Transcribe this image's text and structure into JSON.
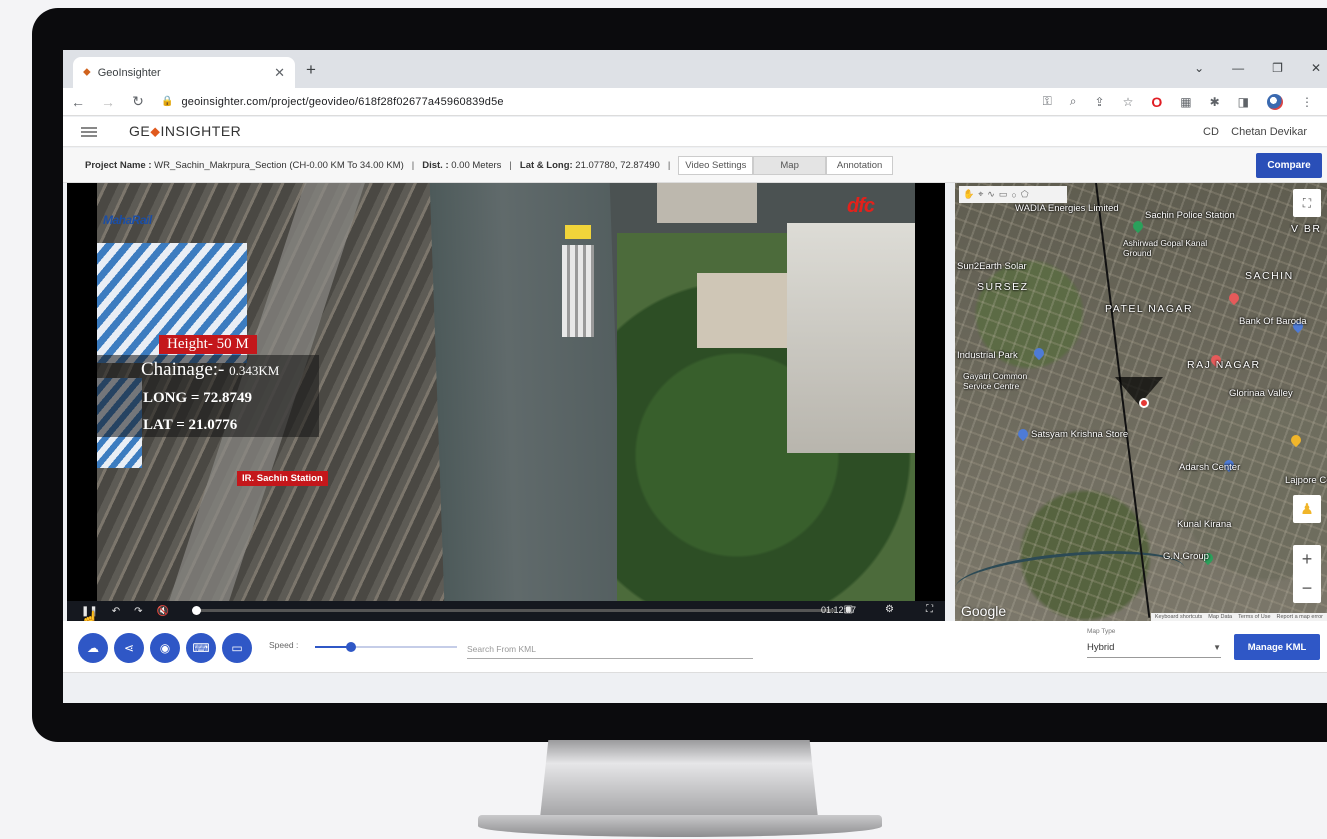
{
  "browser": {
    "tab_title": "GeoInsighter",
    "tab_close": "✕",
    "new_tab": "+",
    "url": "geoinsighter.com/project/geovideo/618f28f02677a45960839d5e",
    "window_controls": [
      "⌄",
      "—",
      "❐",
      "✕"
    ]
  },
  "app": {
    "logo_left": "GE",
    "logo_pin": "⬥",
    "logo_right": "INSIGHTER",
    "user_initials": "CD",
    "user_name": "Chetan Devikar"
  },
  "project_bar": {
    "project_label": "Project Name :",
    "project_value": "WR_Sachin_Makrpura_Section (CH-0.00 KM To 34.00 KM)",
    "dist_label": "Dist. :",
    "dist_value": "0.00 Meters",
    "latlong_label": "Lat & Long:",
    "latlong_value": "21.07780, 72.87490",
    "tabs": [
      "Video Settings",
      "Map",
      "Annotation"
    ],
    "compare_label": "Compare"
  },
  "video": {
    "watermark_left": "MahaRail",
    "watermark_right": "dfc",
    "overlay_height": "Height- 50 M",
    "overlay_chainage_label": "Chainage:- ",
    "overlay_chainage_value": "0.343KM",
    "overlay_long": "LONG = 72.8749",
    "overlay_lat": "LAT = 21.0776",
    "overlay_station": "IR. Sachin Station",
    "time": "01:12:57",
    "progress": 0.0
  },
  "map": {
    "labels": [
      "Sachin Police Station",
      "Ashirwad Gopal Kanal Ground",
      "Sun2Earth Solar",
      "SURSEZ",
      "PATEL NAGAR",
      "Bank Of Baroda",
      "SACHIN",
      "RAJ NAGAR",
      "Glorinaa Valley",
      "Industrial Park",
      "Gayatri Common Service Centre",
      "Satsyam Krishna Store",
      "Adarsh Center",
      "Lajpore Central",
      "Kunal Kirana",
      "G.N.Group",
      "WADIA Energies Limited",
      "V BR"
    ],
    "google": "Google",
    "footer": [
      "Keyboard shortcuts",
      "Map Data",
      "Terms of Use",
      "Report a map error"
    ],
    "zoom_in": "+",
    "zoom_out": "−"
  },
  "controls": {
    "speed_label": "Speed :",
    "speed_value": 0.25,
    "search_placeholder": "Search From KML",
    "map_type_label": "Map Type",
    "map_type_value": "Hybrid",
    "manage_kml": "Manage KML"
  },
  "colors": {
    "accent": "#2f57c6",
    "overlay_red": "#c4171b"
  }
}
